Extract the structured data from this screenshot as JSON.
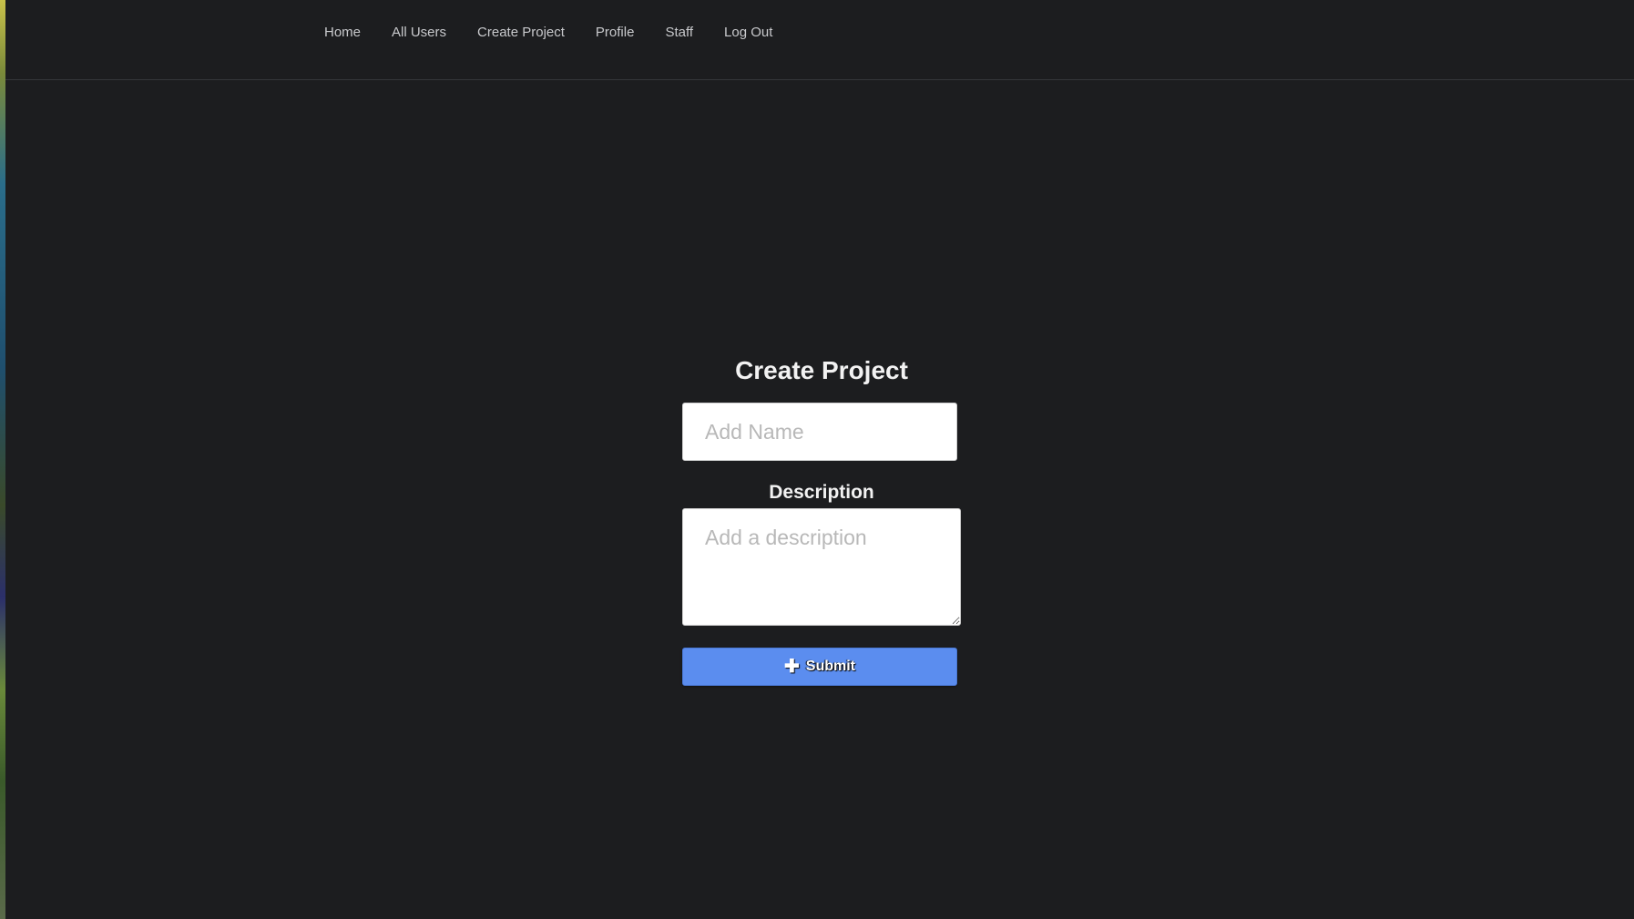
{
  "nav": {
    "items": [
      {
        "label": "Home"
      },
      {
        "label": "All Users"
      },
      {
        "label": "Create Project"
      },
      {
        "label": "Profile"
      },
      {
        "label": "Staff"
      },
      {
        "label": "Log Out"
      }
    ]
  },
  "form": {
    "title": "Create Project",
    "name_placeholder": "Add Name",
    "name_value": "",
    "description_label": "Description",
    "description_placeholder": "Add a description",
    "description_value": "",
    "submit_icon": "plus-icon",
    "submit_label": "Submit"
  },
  "colors": {
    "background": "#1c1d1f",
    "accent": "#5b8def"
  }
}
